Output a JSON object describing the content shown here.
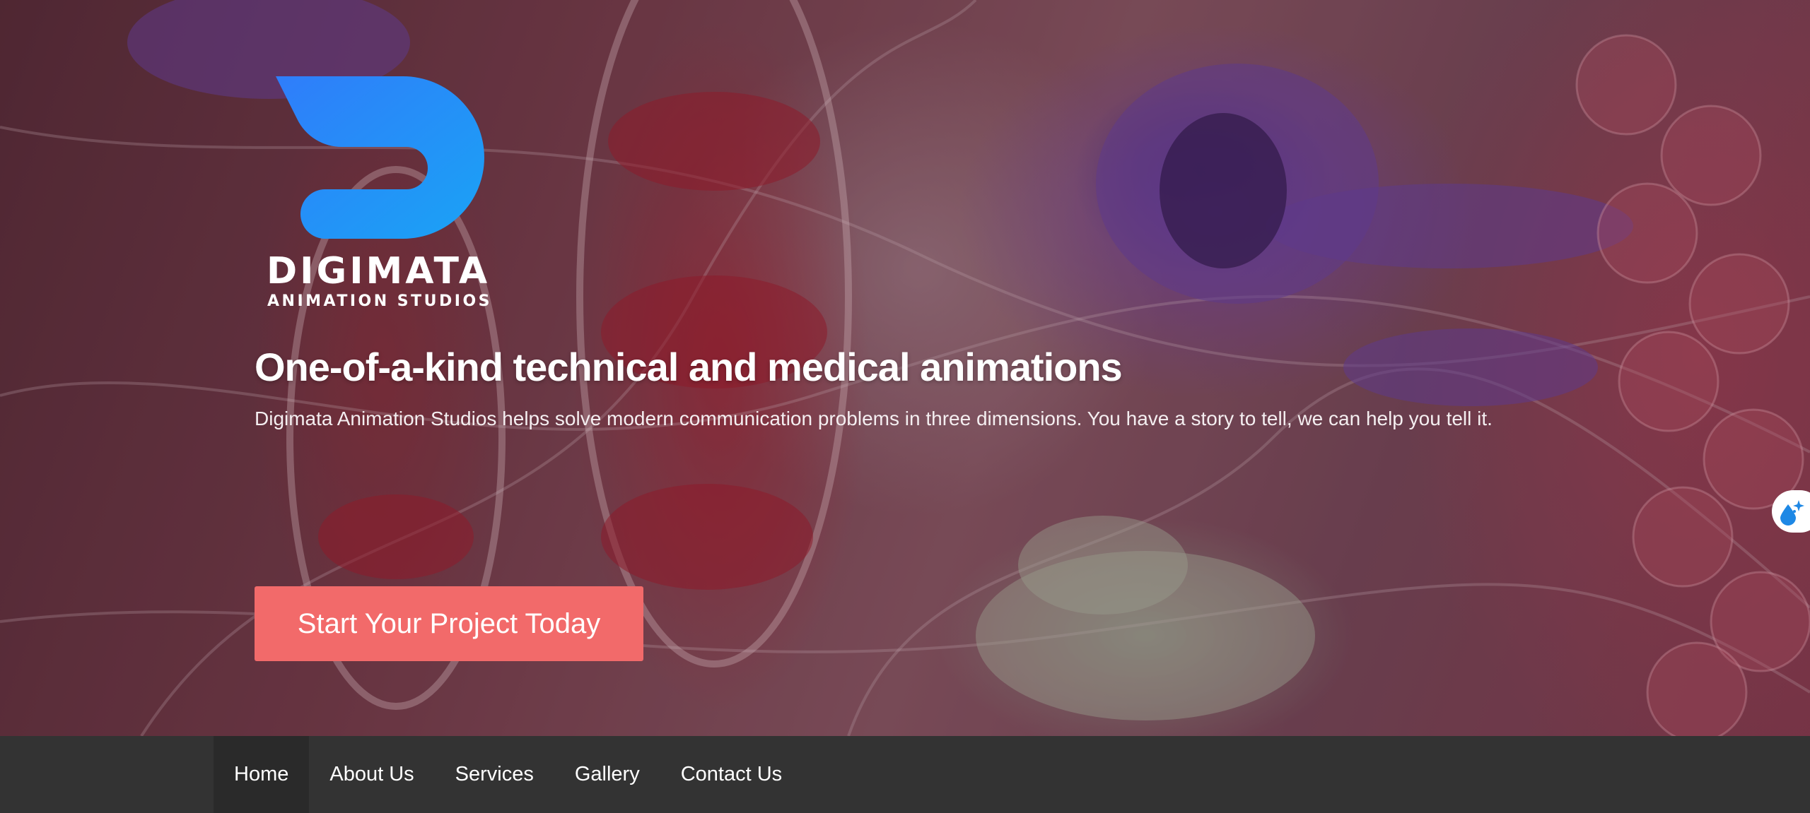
{
  "brand": {
    "name": "DIGIMATA",
    "tagline": "ANIMATION STUDIOS",
    "logo_icon": "digimata-d-logo-icon",
    "logo_gradient": [
      "#2f7dfa",
      "#1aa3f5"
    ]
  },
  "hero": {
    "headline": "One-of-a-kind technical and medical animations",
    "lead": "Digimata Animation Studios helps solve modern communication problems in three dimensions. You have a story to tell, we can help you tell it.",
    "cta_label": "Start Your Project Today",
    "cta_color": "#f26a6a"
  },
  "side_widget": {
    "icon": "droplet-sparkle-icon",
    "color": "#1e88e5"
  },
  "nav": {
    "background": "#333333",
    "items": [
      {
        "label": "Home",
        "active": true
      },
      {
        "label": "About Us",
        "active": false
      },
      {
        "label": "Services",
        "active": false
      },
      {
        "label": "Gallery",
        "active": false
      },
      {
        "label": "Contact Us",
        "active": false
      }
    ]
  }
}
